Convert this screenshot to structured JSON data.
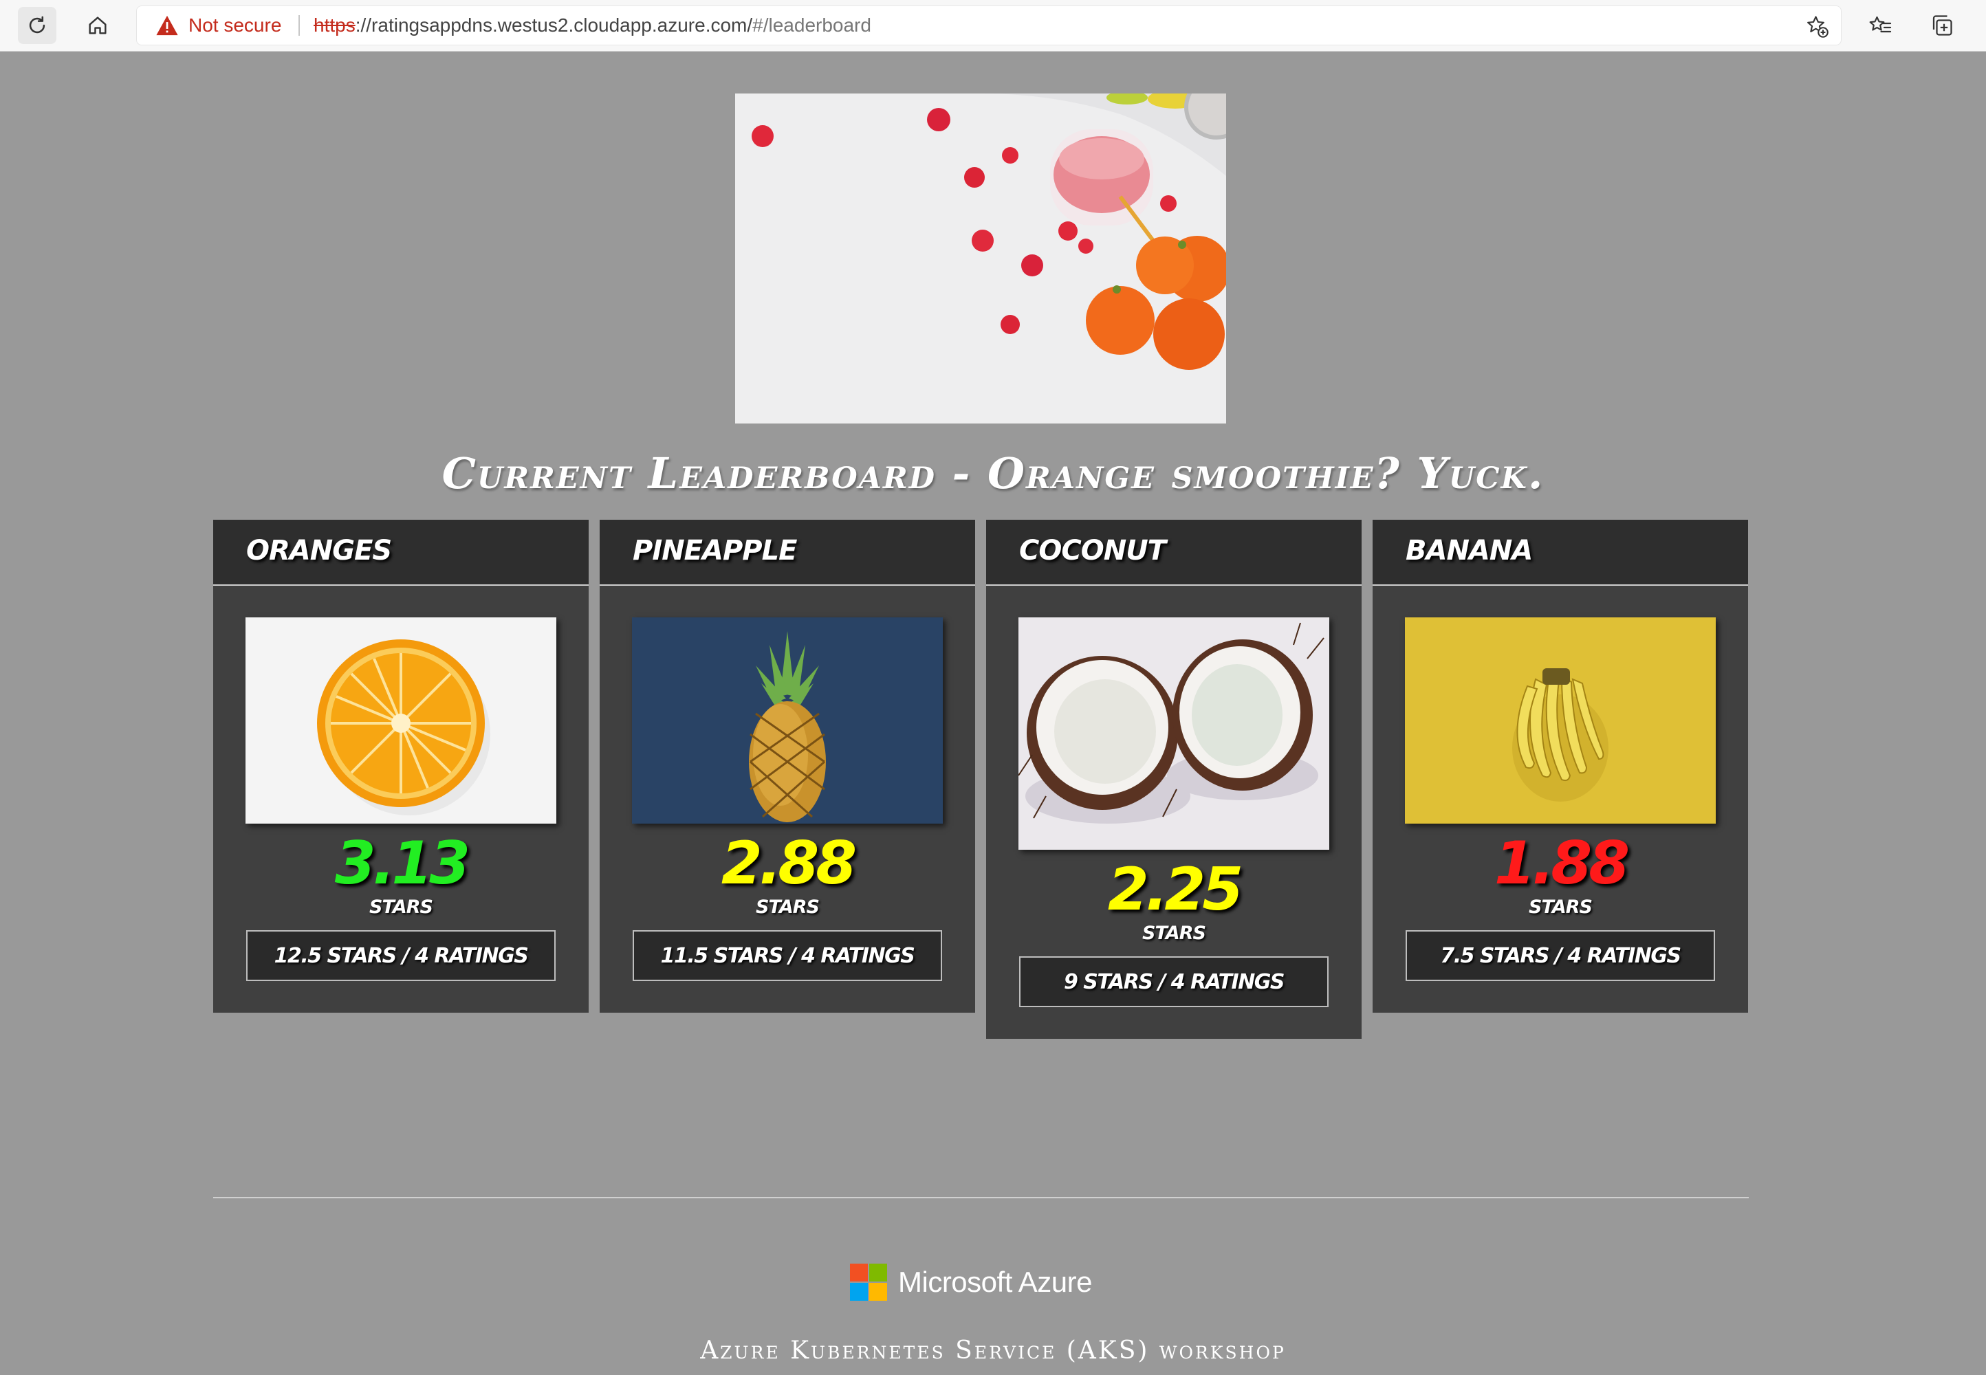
{
  "browser": {
    "security_label": "Not secure",
    "url_scheme": "https",
    "url_host": "://ratingsappdns.westus2.cloudapp.azure.com/",
    "url_path": "#/leaderboard"
  },
  "headline": "Current Leaderboard - Orange smoothie? Yuck.",
  "cards": [
    {
      "name": "ORANGES",
      "score": "3.13",
      "score_color": "#22ee22",
      "stars_label": "STARS",
      "tally": "12.5 STARS / 4 RATINGS"
    },
    {
      "name": "PINEAPPLE",
      "score": "2.88",
      "score_color": "#ffff00",
      "stars_label": "STARS",
      "tally": "11.5 STARS / 4 RATINGS"
    },
    {
      "name": "COCONUT",
      "score": "2.25",
      "score_color": "#ffff00",
      "stars_label": "STARS",
      "tally": "9 STARS / 4 RATINGS"
    },
    {
      "name": "BANANA",
      "score": "1.88",
      "score_color": "#ff1a1a",
      "stars_label": "STARS",
      "tally": "7.5 STARS / 4 RATINGS"
    }
  ],
  "footer": {
    "brand": "Microsoft Azure",
    "caption": "Azure Kubernetes Service (AKS) workshop",
    "colors": {
      "red": "#f25022",
      "green": "#7fba00",
      "blue": "#00a4ef",
      "yellow": "#ffb900"
    }
  }
}
